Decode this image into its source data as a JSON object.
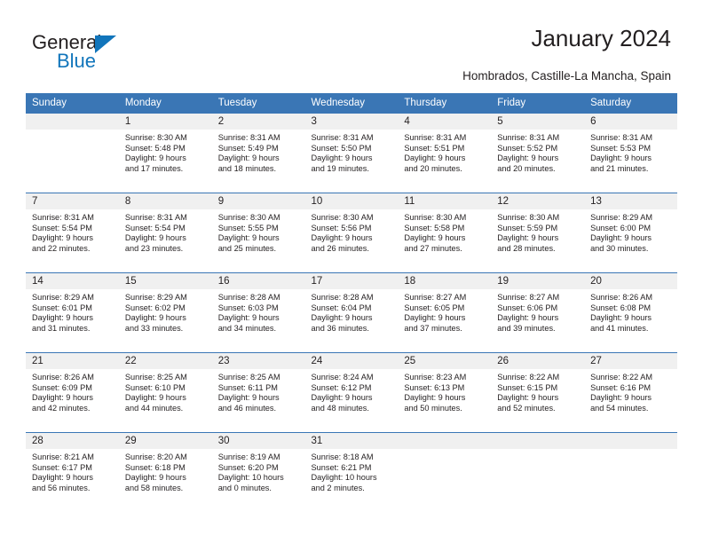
{
  "brand": {
    "name_top": "General",
    "name_bottom": "Blue",
    "color_primary": "#1175bb",
    "color_text": "#231f20"
  },
  "header": {
    "title": "January 2024",
    "subtitle": "Hombrados, Castille-La Mancha, Spain"
  },
  "calendar": {
    "header_bg": "#3a76b5",
    "daynum_bg": "#f0f0f0",
    "weekday_labels": [
      "Sunday",
      "Monday",
      "Tuesday",
      "Wednesday",
      "Thursday",
      "Friday",
      "Saturday"
    ],
    "weeks": [
      [
        {
          "day": "",
          "lines": []
        },
        {
          "day": "1",
          "lines": [
            "Sunrise: 8:30 AM",
            "Sunset: 5:48 PM",
            "Daylight: 9 hours",
            "and 17 minutes."
          ]
        },
        {
          "day": "2",
          "lines": [
            "Sunrise: 8:31 AM",
            "Sunset: 5:49 PM",
            "Daylight: 9 hours",
            "and 18 minutes."
          ]
        },
        {
          "day": "3",
          "lines": [
            "Sunrise: 8:31 AM",
            "Sunset: 5:50 PM",
            "Daylight: 9 hours",
            "and 19 minutes."
          ]
        },
        {
          "day": "4",
          "lines": [
            "Sunrise: 8:31 AM",
            "Sunset: 5:51 PM",
            "Daylight: 9 hours",
            "and 20 minutes."
          ]
        },
        {
          "day": "5",
          "lines": [
            "Sunrise: 8:31 AM",
            "Sunset: 5:52 PM",
            "Daylight: 9 hours",
            "and 20 minutes."
          ]
        },
        {
          "day": "6",
          "lines": [
            "Sunrise: 8:31 AM",
            "Sunset: 5:53 PM",
            "Daylight: 9 hours",
            "and 21 minutes."
          ]
        }
      ],
      [
        {
          "day": "7",
          "lines": [
            "Sunrise: 8:31 AM",
            "Sunset: 5:54 PM",
            "Daylight: 9 hours",
            "and 22 minutes."
          ]
        },
        {
          "day": "8",
          "lines": [
            "Sunrise: 8:31 AM",
            "Sunset: 5:54 PM",
            "Daylight: 9 hours",
            "and 23 minutes."
          ]
        },
        {
          "day": "9",
          "lines": [
            "Sunrise: 8:30 AM",
            "Sunset: 5:55 PM",
            "Daylight: 9 hours",
            "and 25 minutes."
          ]
        },
        {
          "day": "10",
          "lines": [
            "Sunrise: 8:30 AM",
            "Sunset: 5:56 PM",
            "Daylight: 9 hours",
            "and 26 minutes."
          ]
        },
        {
          "day": "11",
          "lines": [
            "Sunrise: 8:30 AM",
            "Sunset: 5:58 PM",
            "Daylight: 9 hours",
            "and 27 minutes."
          ]
        },
        {
          "day": "12",
          "lines": [
            "Sunrise: 8:30 AM",
            "Sunset: 5:59 PM",
            "Daylight: 9 hours",
            "and 28 minutes."
          ]
        },
        {
          "day": "13",
          "lines": [
            "Sunrise: 8:29 AM",
            "Sunset: 6:00 PM",
            "Daylight: 9 hours",
            "and 30 minutes."
          ]
        }
      ],
      [
        {
          "day": "14",
          "lines": [
            "Sunrise: 8:29 AM",
            "Sunset: 6:01 PM",
            "Daylight: 9 hours",
            "and 31 minutes."
          ]
        },
        {
          "day": "15",
          "lines": [
            "Sunrise: 8:29 AM",
            "Sunset: 6:02 PM",
            "Daylight: 9 hours",
            "and 33 minutes."
          ]
        },
        {
          "day": "16",
          "lines": [
            "Sunrise: 8:28 AM",
            "Sunset: 6:03 PM",
            "Daylight: 9 hours",
            "and 34 minutes."
          ]
        },
        {
          "day": "17",
          "lines": [
            "Sunrise: 8:28 AM",
            "Sunset: 6:04 PM",
            "Daylight: 9 hours",
            "and 36 minutes."
          ]
        },
        {
          "day": "18",
          "lines": [
            "Sunrise: 8:27 AM",
            "Sunset: 6:05 PM",
            "Daylight: 9 hours",
            "and 37 minutes."
          ]
        },
        {
          "day": "19",
          "lines": [
            "Sunrise: 8:27 AM",
            "Sunset: 6:06 PM",
            "Daylight: 9 hours",
            "and 39 minutes."
          ]
        },
        {
          "day": "20",
          "lines": [
            "Sunrise: 8:26 AM",
            "Sunset: 6:08 PM",
            "Daylight: 9 hours",
            "and 41 minutes."
          ]
        }
      ],
      [
        {
          "day": "21",
          "lines": [
            "Sunrise: 8:26 AM",
            "Sunset: 6:09 PM",
            "Daylight: 9 hours",
            "and 42 minutes."
          ]
        },
        {
          "day": "22",
          "lines": [
            "Sunrise: 8:25 AM",
            "Sunset: 6:10 PM",
            "Daylight: 9 hours",
            "and 44 minutes."
          ]
        },
        {
          "day": "23",
          "lines": [
            "Sunrise: 8:25 AM",
            "Sunset: 6:11 PM",
            "Daylight: 9 hours",
            "and 46 minutes."
          ]
        },
        {
          "day": "24",
          "lines": [
            "Sunrise: 8:24 AM",
            "Sunset: 6:12 PM",
            "Daylight: 9 hours",
            "and 48 minutes."
          ]
        },
        {
          "day": "25",
          "lines": [
            "Sunrise: 8:23 AM",
            "Sunset: 6:13 PM",
            "Daylight: 9 hours",
            "and 50 minutes."
          ]
        },
        {
          "day": "26",
          "lines": [
            "Sunrise: 8:22 AM",
            "Sunset: 6:15 PM",
            "Daylight: 9 hours",
            "and 52 minutes."
          ]
        },
        {
          "day": "27",
          "lines": [
            "Sunrise: 8:22 AM",
            "Sunset: 6:16 PM",
            "Daylight: 9 hours",
            "and 54 minutes."
          ]
        }
      ],
      [
        {
          "day": "28",
          "lines": [
            "Sunrise: 8:21 AM",
            "Sunset: 6:17 PM",
            "Daylight: 9 hours",
            "and 56 minutes."
          ]
        },
        {
          "day": "29",
          "lines": [
            "Sunrise: 8:20 AM",
            "Sunset: 6:18 PM",
            "Daylight: 9 hours",
            "and 58 minutes."
          ]
        },
        {
          "day": "30",
          "lines": [
            "Sunrise: 8:19 AM",
            "Sunset: 6:20 PM",
            "Daylight: 10 hours",
            "and 0 minutes."
          ]
        },
        {
          "day": "31",
          "lines": [
            "Sunrise: 8:18 AM",
            "Sunset: 6:21 PM",
            "Daylight: 10 hours",
            "and 2 minutes."
          ]
        },
        {
          "day": "",
          "lines": []
        },
        {
          "day": "",
          "lines": []
        },
        {
          "day": "",
          "lines": []
        }
      ]
    ]
  }
}
